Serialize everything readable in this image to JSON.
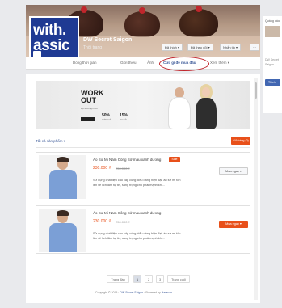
{
  "page": {
    "name": "DW Secret Saigon",
    "category": "Thời trang",
    "profile_logo_text": "with.\nassic"
  },
  "cover_buttons": {
    "liked": "Đã thích ▾",
    "following": "Đã theo dõi ▾",
    "message": "Nhắn tin ▾",
    "more": "···"
  },
  "nav": {
    "items": [
      "Dòng thời gian",
      "Giới thiệu",
      "Ảnh",
      "Cửa gì để mua đầu",
      "Xem thêm ▾"
    ],
    "active_index": 3
  },
  "banner": {
    "headline": "WORK\nOUT",
    "subline": "Bộ sưu tập mới",
    "pct1": "50%",
    "pct1_label": "GIẢM GIÁ",
    "pct2": "15%",
    "pct2_label": "ƯU ĐÃI"
  },
  "shop": {
    "category_link": "Tất cả sản phẩm ▾",
    "cart_button": "Giỏ hàng (0)"
  },
  "products": [
    {
      "title": "Áo Sơ Mi Nam Công Sở màu xanh dương",
      "badge": "Sale",
      "price": "230.000 ₫",
      "old_price": "250.000 ₫",
      "description": "Sử dụng chất liệu cao cấp cùng kiểu dáng hiện đại, áo sơ mi tôn lên vẻ lịch lãm tự tin, sang trọng cho phái mạnh khi...",
      "button": "Mua ngay ▾"
    },
    {
      "title": "Áo Sơ Mi Nam Công Sở màu xanh dương",
      "badge": "",
      "price": "230.000 ₫",
      "old_price": "250.000 ₫",
      "description": "Sử dụng chất liệu cao cấp cùng kiểu dáng hiện đại, áo sơ mi tôn lên vẻ lịch lãm tự tin, sang trọng cho phái mạnh khi...",
      "button": "Mua ngay ▾"
    }
  ],
  "pagination": {
    "prev": "Trang đầu",
    "pages": [
      "1",
      "2",
      "3"
    ],
    "next": "Trang cuối",
    "active_page": "1"
  },
  "footer": {
    "copyright": "Copyright © 2015 · ",
    "link": "DW Secret Saigon",
    "powered": " · Powered by ",
    "powered_link": "Haravan"
  },
  "right_column": {
    "title": "Quảng cáo",
    "line1": "DW Secret",
    "line2": "Saigon",
    "button": "Thích"
  },
  "colors": {
    "accent": "#e8501a",
    "link": "#3b5998",
    "highlight_ring": "#c0262c"
  }
}
